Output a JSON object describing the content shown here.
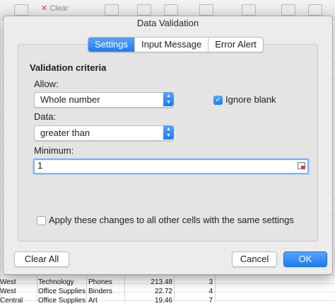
{
  "toolbar": {
    "clear_label": "Clear"
  },
  "sheet_rows": [
    {
      "region": "West",
      "category": "Technology",
      "sub_category": "Phones",
      "sales": "213.48",
      "quantity": "3"
    },
    {
      "region": "West",
      "category": "Office Supplies",
      "sub_category": "Binders",
      "sales": "22.72",
      "quantity": "4"
    },
    {
      "region": "Central",
      "category": "Office Supplies",
      "sub_category": "Art",
      "sales": "19.46",
      "quantity": "7"
    }
  ],
  "dialog": {
    "title": "Data Validation",
    "tabs": [
      {
        "label": "Settings",
        "active": true
      },
      {
        "label": "Input Message",
        "active": false
      },
      {
        "label": "Error Alert",
        "active": false
      }
    ],
    "section_title": "Validation criteria",
    "allow_label": "Allow:",
    "allow_value": "Whole number",
    "ignore_blank_label": "Ignore blank",
    "ignore_blank_checked": true,
    "data_label": "Data:",
    "data_value": "greater than",
    "minimum_label": "Minimum:",
    "minimum_value": "1",
    "apply_label": "Apply these changes to all other cells with the same settings",
    "apply_checked": false,
    "clear_all_label": "Clear All",
    "cancel_label": "Cancel",
    "ok_label": "OK"
  },
  "colors": {
    "accent": "#1b7cf1",
    "dialog_bg": "#ececec",
    "panel_bg": "#e4e4e4"
  }
}
